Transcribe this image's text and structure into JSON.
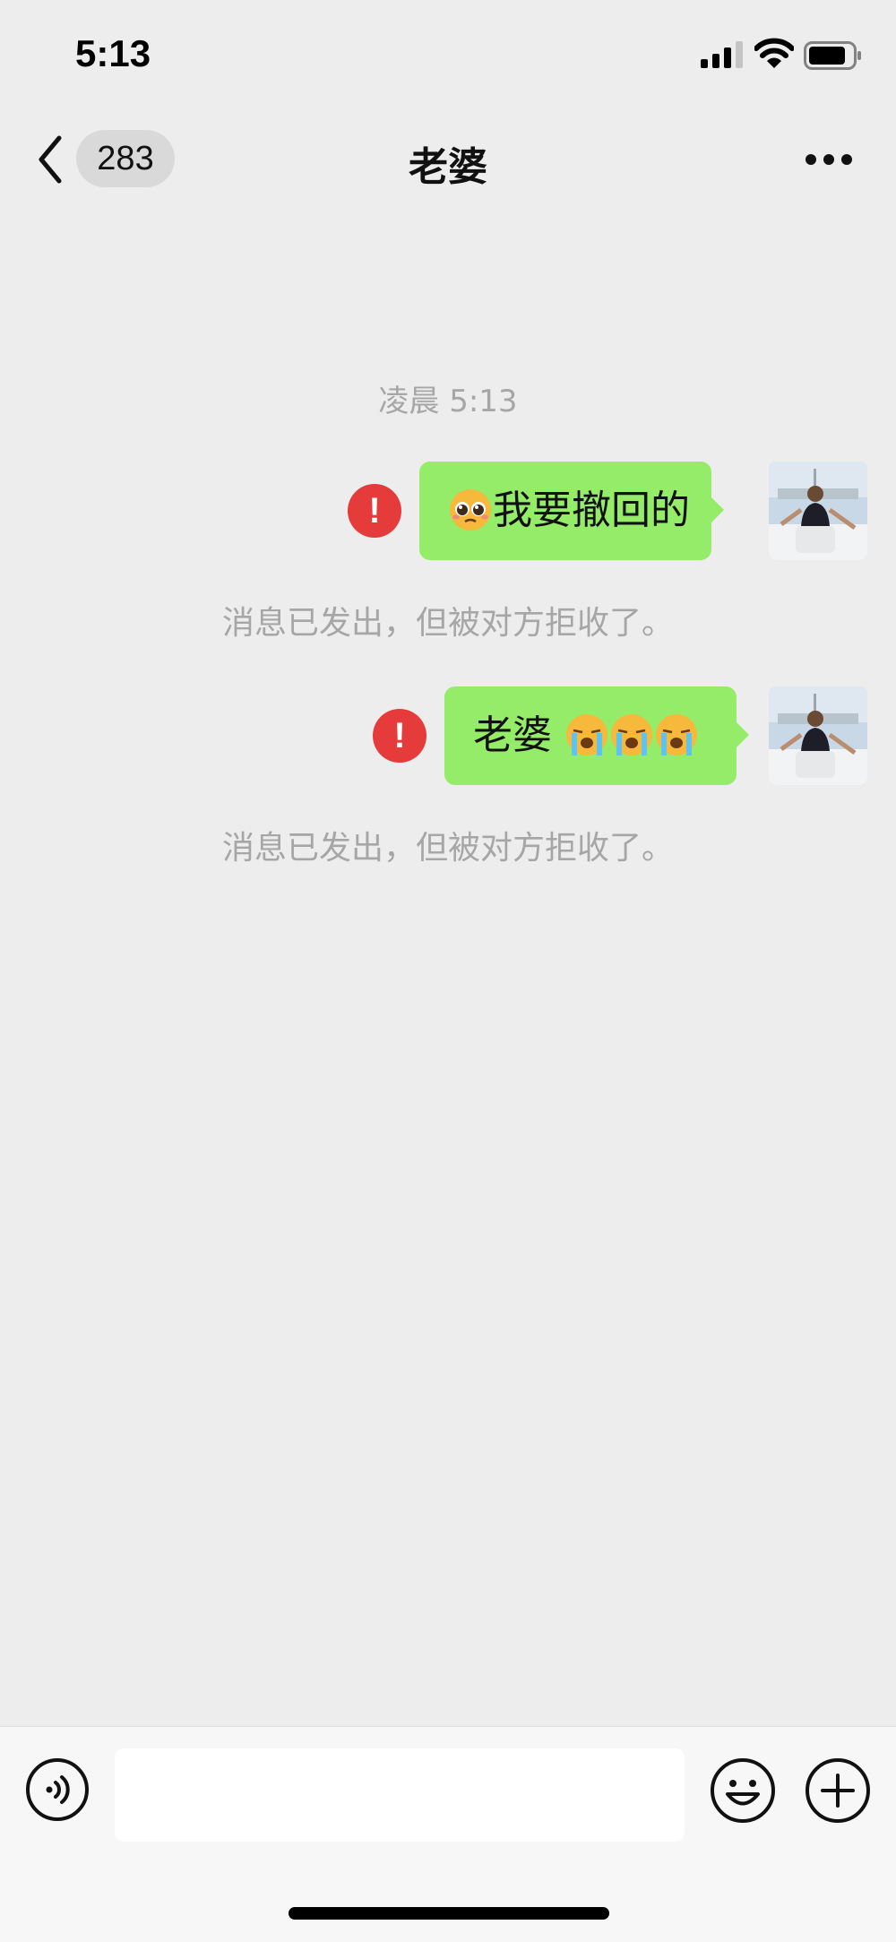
{
  "status_bar": {
    "time": "5:13"
  },
  "nav": {
    "unread_count": "283",
    "title": "老婆"
  },
  "chat": {
    "timestamp": "凌晨 5:13",
    "messages": [
      {
        "emoji_prefix": "pleading-face",
        "text": "我要撤回的",
        "failed": true,
        "notice": "消息已发出，但被对方拒收了。"
      },
      {
        "text": "老婆",
        "emoji_suffix": [
          "loudly-crying-face",
          "loudly-crying-face",
          "loudly-crying-face"
        ],
        "failed": true,
        "notice": "消息已发出，但被对方拒收了。"
      }
    ],
    "error_mark": "!"
  },
  "input_bar": {
    "placeholder": ""
  },
  "colors": {
    "bubble": "#95ec69",
    "error": "#e63b3b",
    "background": "#ededed"
  }
}
